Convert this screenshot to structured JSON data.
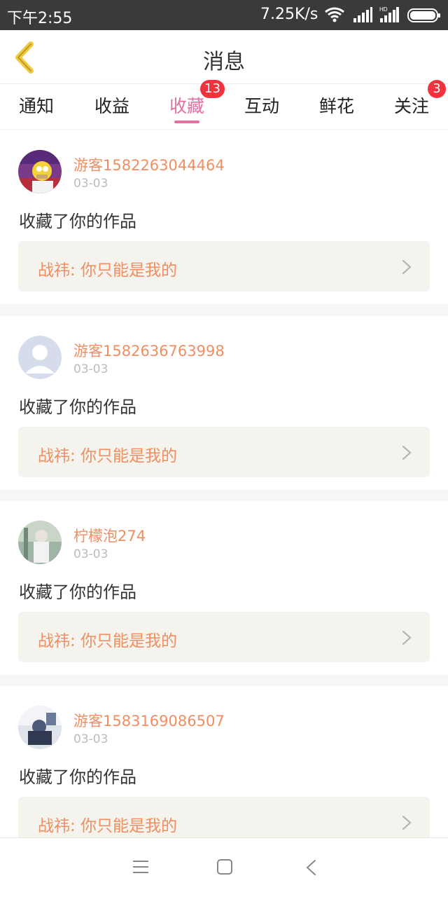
{
  "status_bar": {
    "time": "下午2:55",
    "network_speed": "7.25K/s",
    "icons": [
      "wifi-icon",
      "signal-icon",
      "hd-signal-icon",
      "battery-icon"
    ]
  },
  "header": {
    "title": "消息",
    "back_icon": "chevron-left-icon"
  },
  "tabs": [
    {
      "label": "通知",
      "badge": ""
    },
    {
      "label": "收益",
      "badge": ""
    },
    {
      "label": "收藏",
      "badge": "13",
      "active": true
    },
    {
      "label": "互动",
      "badge": ""
    },
    {
      "label": "鲜花",
      "badge": ""
    },
    {
      "label": "关注",
      "badge": "3"
    }
  ],
  "messages": [
    {
      "username": "游客1582263044464",
      "date": "03-03",
      "action": "收藏了你的作品",
      "work": "战祎: 你只能是我的",
      "avatar": "cartoon-avatar"
    },
    {
      "username": "游客1582636763998",
      "date": "03-03",
      "action": "收藏了你的作品",
      "work": "战祎: 你只能是我的",
      "avatar": "default-avatar"
    },
    {
      "username": "柠檬泡274",
      "date": "03-03",
      "action": "收藏了你的作品",
      "work": "战祎: 你只能是我的",
      "avatar": "photo-avatar"
    },
    {
      "username": "游客1583169086507",
      "date": "03-03",
      "action": "收藏了你的作品",
      "work": "战祎: 你只能是我的",
      "avatar": "photo-avatar"
    }
  ],
  "colors": {
    "accent_pink": "#e56fa2",
    "orange_text": "#f08e62",
    "badge_red": "#f2333d",
    "back_arrow_yellow": "#f3c93d"
  },
  "nav_bar": {
    "icons": [
      "menu-icon",
      "home-square-icon",
      "back-arrow-icon"
    ]
  }
}
